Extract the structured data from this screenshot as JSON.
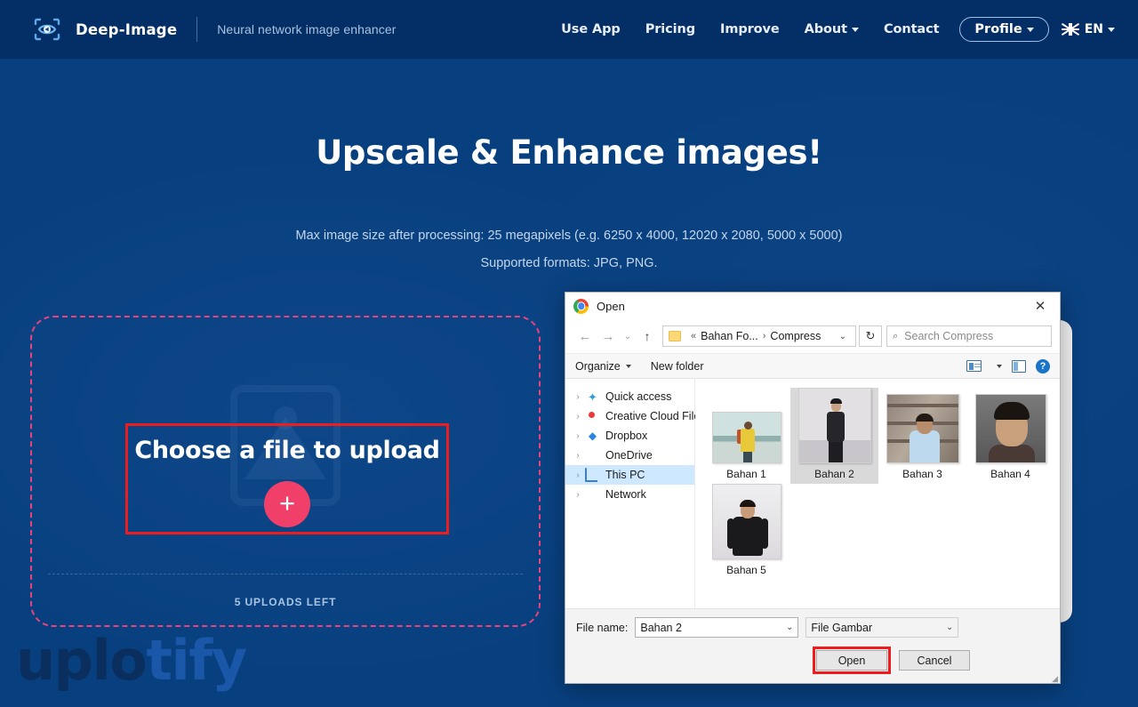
{
  "header": {
    "brand_name": "Deep-Image",
    "tagline": "Neural network image enhancer",
    "nav": [
      {
        "label": "Use App",
        "caret": false
      },
      {
        "label": "Pricing",
        "caret": false
      },
      {
        "label": "Improve",
        "caret": false
      },
      {
        "label": "About",
        "caret": true
      },
      {
        "label": "Contact",
        "caret": false
      }
    ],
    "profile_label": "Profile",
    "lang_label": "EN",
    "bg_color": "#042f66"
  },
  "hero": {
    "title": "Upscale & Enhance images!",
    "line1": "Max image size after processing: 25 megapixels (e.g. 6250 x 4000, 12020 x 2080, 5000 x 5000)",
    "line2": "Supported formats: JPG, PNG."
  },
  "dropzone": {
    "cta": "Choose a file to upload",
    "plus": "+",
    "uploads_left": "5 UPLOADS LEFT",
    "border_color": "#e8437f",
    "plus_color": "#f0406a",
    "highlight_color": "#ee1c1c"
  },
  "watermark": {
    "part1": "uplo",
    "part2": "tify"
  },
  "dialog": {
    "title": "Open",
    "close_glyph": "✕",
    "nav": {
      "back_glyph": "←",
      "forward_glyph": "→",
      "recent_glyph": "⌄",
      "up_glyph": "↑",
      "refresh_glyph": "↻"
    },
    "breadcrumb": {
      "prefix": "«",
      "parent": "Bahan Fo...",
      "separator": "›",
      "current": "Compress",
      "chevron": "⌄"
    },
    "search": {
      "placeholder": "Search Compress",
      "icon": "⌕"
    },
    "toolbar": {
      "organize": "Organize",
      "new_folder": "New folder",
      "help_glyph": "?"
    },
    "sidebar": [
      {
        "label": "Quick access",
        "icon": "star-icon",
        "selected": false
      },
      {
        "label": "Creative Cloud Files",
        "icon": "creative-cloud-icon",
        "selected": false
      },
      {
        "label": "Dropbox",
        "icon": "dropbox-icon",
        "selected": false
      },
      {
        "label": "OneDrive",
        "icon": "onedrive-icon",
        "selected": false
      },
      {
        "label": "This PC",
        "icon": "this-pc-icon",
        "selected": true
      },
      {
        "label": "Network",
        "icon": "network-icon",
        "selected": false
      }
    ],
    "files": [
      {
        "name": "Bahan 1",
        "selected": false
      },
      {
        "name": "Bahan 2",
        "selected": true
      },
      {
        "name": "Bahan 3",
        "selected": false
      },
      {
        "name": "Bahan 4",
        "selected": false
      },
      {
        "name": "Bahan 5",
        "selected": false
      }
    ],
    "footer": {
      "filename_label": "File name:",
      "filename_value": "Bahan 2",
      "filetype_value": "File Gambar",
      "open_button": "Open",
      "cancel_button": "Cancel"
    }
  }
}
